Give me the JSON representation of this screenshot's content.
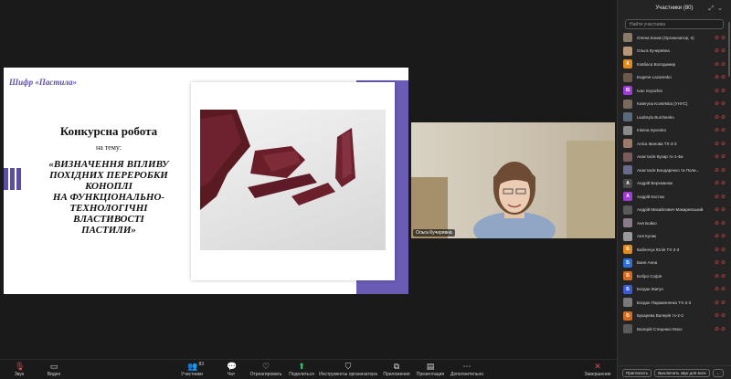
{
  "slide": {
    "cipher": "Шифр «Пастила»",
    "heading": "Конкурсна робота",
    "subheading": "на тему:",
    "topic": "«ВИЗНАЧЕННЯ ВПЛИВУ\nПОХІДНИХ ПЕРЕРОБКИ\nКОНОПЛІ\nНА ФУНКЦІОНАЛЬНО-\nТЕХНОЛОГІЧНІ\nВЛАСТИВОСТІ\nПАСТИЛИ»"
  },
  "video": {
    "name": "Ольга Кучерявна"
  },
  "toolbar": {
    "audio": "Звук",
    "video": "Видео",
    "participants": "Участники",
    "participants_count": "83",
    "chat": "Чат",
    "react": "Отреагировать",
    "share": "Поделиться",
    "host_tools": "Инструменты организатора",
    "apps": "Приложения",
    "whiteboards": "Презентация",
    "more": "Дополнительно",
    "end": "Завершение"
  },
  "panel": {
    "title": "Участники (80)",
    "search_placeholder": "Найти участника",
    "participants": [
      {
        "name": "Олена Конак (Организатор, я)",
        "initial": "",
        "color": "#8a7a6a"
      },
      {
        "name": "Ольга Кучерявна",
        "initial": "",
        "color": "#b8967a"
      },
      {
        "name": "Ковбаса Володимир",
        "initial": "К",
        "color": "#e08a1e"
      },
      {
        "name": "Eugene Lazarenko",
        "initial": "",
        "color": "#6b5a4a"
      },
      {
        "name": "Ivan Svyazhin",
        "initial": "IS",
        "color": "#a13bd6"
      },
      {
        "name": "Kateryna Kovtetska (УНУС)",
        "initial": "",
        "color": "#7a6a5a"
      },
      {
        "name": "Liudmyla Burchenko",
        "initial": "",
        "color": "#5a6a7a"
      },
      {
        "name": "Inkena Syvenko",
        "initial": "",
        "color": "#8a8a8a"
      },
      {
        "name": "Аліса Іванова ТХ-3-3",
        "initial": "",
        "color": "#9a7a6a"
      },
      {
        "name": "Анастасія Кухар тх-1-4м",
        "initial": "",
        "color": "#7a5a5a"
      },
      {
        "name": "Анастасія Бондаренко та Поли...",
        "initial": "",
        "color": "#6a6a8a"
      },
      {
        "name": "Андрій Верхманюк",
        "initial": "A",
        "color": "#4a4a4a"
      },
      {
        "name": "Андрій Костюк",
        "initial": "A",
        "color": "#a13bd6"
      },
      {
        "name": "Андрій Михайлович Макаревський",
        "initial": "",
        "color": "#5a5a5a"
      },
      {
        "name": "Аня Бойко",
        "initial": "",
        "color": "#8a7a8a"
      },
      {
        "name": "Аня Кулик",
        "initial": "",
        "color": "#9a9a9a"
      },
      {
        "name": "Бабенчук Юлія ТХ-3-3",
        "initial": "Б",
        "color": "#e08a1e"
      },
      {
        "name": "Баня Анна",
        "initial": "Б",
        "color": "#2f6fd6"
      },
      {
        "name": "Бобро Софія",
        "initial": "Б",
        "color": "#d66a1e"
      },
      {
        "name": "Богдан Жигун",
        "initial": "Б",
        "color": "#3b5bd6"
      },
      {
        "name": "Богдан Парамоненко ТХ-3-3",
        "initial": "",
        "color": "#7a7a7a"
      },
      {
        "name": "Букарева Валерія тх-2-2",
        "initial": "Б",
        "color": "#d66a1e"
      },
      {
        "name": "Валерій Стеценко Мэхх",
        "initial": "",
        "color": "#5a5a5a"
      }
    ],
    "invite": "Пригласить",
    "mute_all": "Выключить звук для всех",
    "more": "..."
  }
}
